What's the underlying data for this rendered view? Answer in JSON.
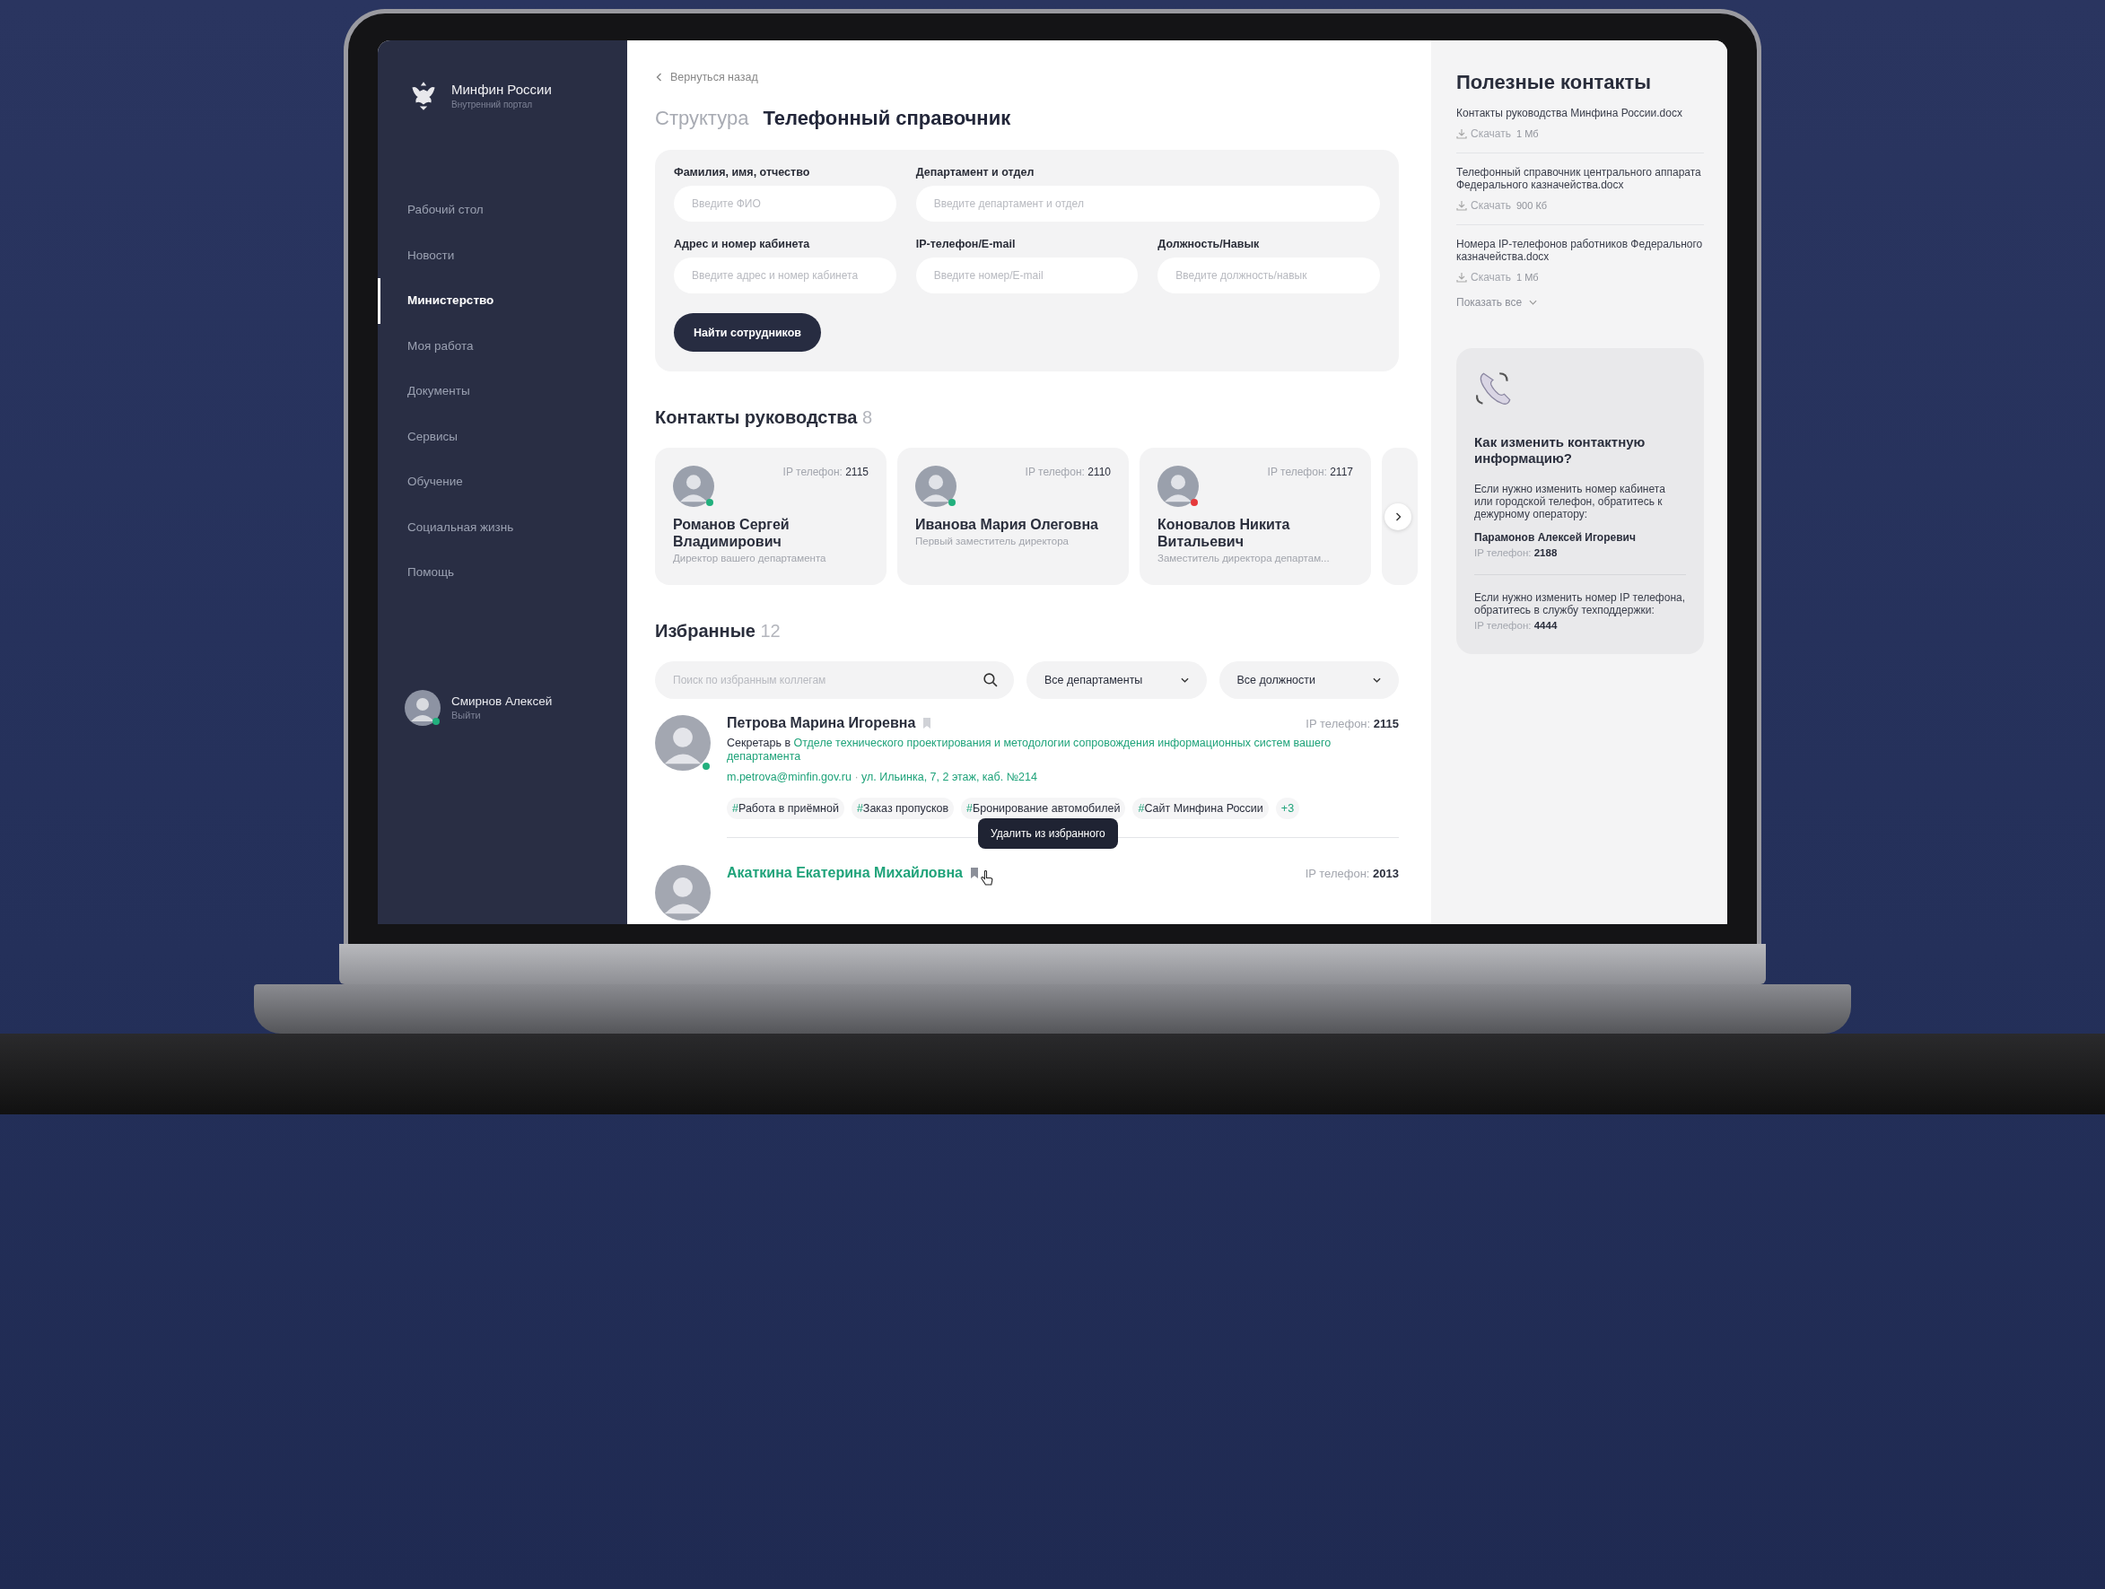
{
  "sidebar": {
    "brand": {
      "title": "Минфин России",
      "subtitle": "Внутренний портал"
    },
    "items": [
      {
        "label": "Рабочий стол",
        "selected": false
      },
      {
        "label": "Новости",
        "selected": false
      },
      {
        "label": "Министерство",
        "selected": true
      },
      {
        "label": "Моя работа",
        "selected": false
      },
      {
        "label": "Документы",
        "selected": false
      },
      {
        "label": "Сервисы",
        "selected": false
      },
      {
        "label": "Обучение",
        "selected": false
      },
      {
        "label": "Социальная жизнь",
        "selected": false
      },
      {
        "label": "Помощь",
        "selected": false
      }
    ],
    "user": {
      "name": "Смирнов Алексей",
      "action": "Выйти",
      "color": "#22b07d"
    }
  },
  "main": {
    "back_link": "Вернуться назад",
    "breadcrumb": [
      {
        "label": "Структура",
        "selected": false
      },
      {
        "label": "Телефонный справочник",
        "selected": true
      }
    ],
    "filter": {
      "rows": [
        [
          {
            "label": "Фамилия, имя, отчество",
            "placeholder": "Введите ФИО"
          },
          {
            "label": "Департамент и отдел",
            "placeholder": "Введите департамент и отдел"
          }
        ],
        [
          {
            "label": "Адрес и номер кабинета",
            "placeholder": "Введите адрес и номер кабинета"
          },
          {
            "label": "IP-телефон/E-mail",
            "placeholder": "Введите номер/E-mail"
          },
          {
            "label": "Должность/Навык",
            "placeholder": "Введите должность/навык"
          }
        ]
      ],
      "button": "Найти сотрудников"
    },
    "leaders": {
      "title": "Контакты руководства",
      "count": "8",
      "cards": [
        {
          "name": "Романов Сергей Владимирович",
          "position": "Директор вашего департамента",
          "phone_label": "IP телефон:",
          "phone": "2115",
          "color": "#22b07d"
        },
        {
          "name": "Иванова Мария Олеговна",
          "position": "Первый заместитель директора",
          "phone_label": "IP телефон:",
          "phone": "2110",
          "color": "#22b07d"
        },
        {
          "name": "Коновалов Никита Витальевич",
          "position": "Заместитель директора департам...",
          "phone_label": "IP телефон:",
          "phone": "2117",
          "color": "#e5393b"
        }
      ]
    },
    "favorites": {
      "title": "Избранные",
      "count": "12",
      "search_placeholder": "Поиск по избранным коллегам",
      "dropdowns": [
        "Все департаменты",
        "Все должности"
      ],
      "people": [
        {
          "name": "Петрова Марина Игоревна",
          "highlighted": false,
          "color": "#22b07d",
          "phone_label": "IP телефон:",
          "phone": "2115",
          "role": "Секретарь в",
          "department": "Отделе технического проектирования и методологии сопровождения информационных систем вашего департамента",
          "email": "m.petrova@minfin.gov.ru",
          "separator": "·",
          "address": "ул. Ильинка, 7, 2 этаж, каб. №214",
          "tags": [
            {
              "mark": "#",
              "text": "Работа в приёмной"
            },
            {
              "mark": "#",
              "text": "Заказ пропусков"
            },
            {
              "mark": "#",
              "text": "Бронирование автомобилей"
            },
            {
              "mark": "#",
              "text": "Сайт Минфина России"
            }
          ],
          "more": "+3"
        },
        {
          "name": "Акаткина Екатерина Михайловна",
          "highlighted": true,
          "phone_label": "IP телефон:",
          "phone": "2013",
          "tooltip": "Удалить из избранного"
        }
      ]
    }
  },
  "aside": {
    "title": "Полезные контакты",
    "documents": [
      {
        "name": "Контакты руководства Минфина России.docx",
        "action": "Скачать",
        "size": "1 Мб"
      },
      {
        "name": "Телефонный справочник центрального аппарата Федерального казначейства.docx",
        "action": "Скачать",
        "size": "900 Кб"
      },
      {
        "name": "Номера IP-телефонов работников Федерального казначейства.docx",
        "action": "Скачать",
        "size": "1 Мб"
      }
    ],
    "show_all": "Показать все",
    "help": {
      "title": "Как изменить контактную информацию?",
      "blocks": [
        {
          "text": "Если нужно изменить номер кабинета или городской телефон, обратитесь к дежурному оператору:",
          "contact": "Парамонов Алексей  Игоревич",
          "phone_label": "IP телефон:",
          "phone": "2188"
        },
        {
          "text": "Если нужно изменить номер IP телефона, обратитесь в службу техподдержки:",
          "phone_label": "IP телефон:",
          "phone": "4444"
        }
      ]
    }
  }
}
